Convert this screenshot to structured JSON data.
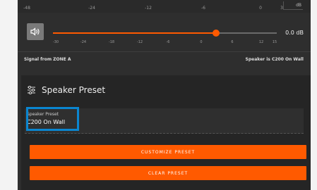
{
  "meter": {
    "ticks": [
      "-48",
      "-24",
      "-12",
      "-6",
      "0",
      "3"
    ],
    "unit": "dB"
  },
  "volume": {
    "value_label": "0.0 dB",
    "level_fraction": 0.73,
    "ticks": [
      "-30",
      "-24",
      "-18",
      "-12",
      "-6",
      "0",
      "6",
      "12",
      "15"
    ],
    "icon": "speaker-icon"
  },
  "signal": {
    "source": "Signal from ZONE A",
    "speaker": "Speaker is C200 On Wall"
  },
  "preset": {
    "title": "Speaker Preset",
    "icon": "sliders-icon",
    "field_label": "Speaker Preset",
    "field_value": "C200 On Wall",
    "customize_label": "CUSTOMIZE PRESET",
    "clear_label": "CLEAR PRESET"
  },
  "colors": {
    "accent": "#ff5a00",
    "highlight": "#0a86d1"
  }
}
